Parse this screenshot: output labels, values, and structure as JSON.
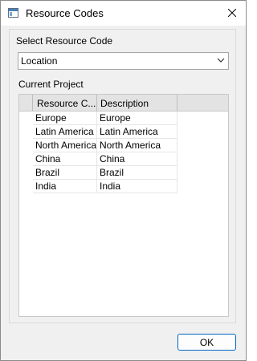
{
  "window": {
    "title": "Resource Codes"
  },
  "select_section": {
    "label": "Select Resource Code",
    "selected": "Location"
  },
  "project_section": {
    "label": "Current Project"
  },
  "grid": {
    "columns": [
      "Resource C...",
      "Description"
    ],
    "rows": [
      [
        "Europe",
        "Europe"
      ],
      [
        "Latin America",
        "Latin America"
      ],
      [
        "North America",
        "North America"
      ],
      [
        "China",
        "China"
      ],
      [
        "Brazil",
        "Brazil"
      ],
      [
        "India",
        "India"
      ]
    ]
  },
  "buttons": {
    "ok": "OK"
  }
}
